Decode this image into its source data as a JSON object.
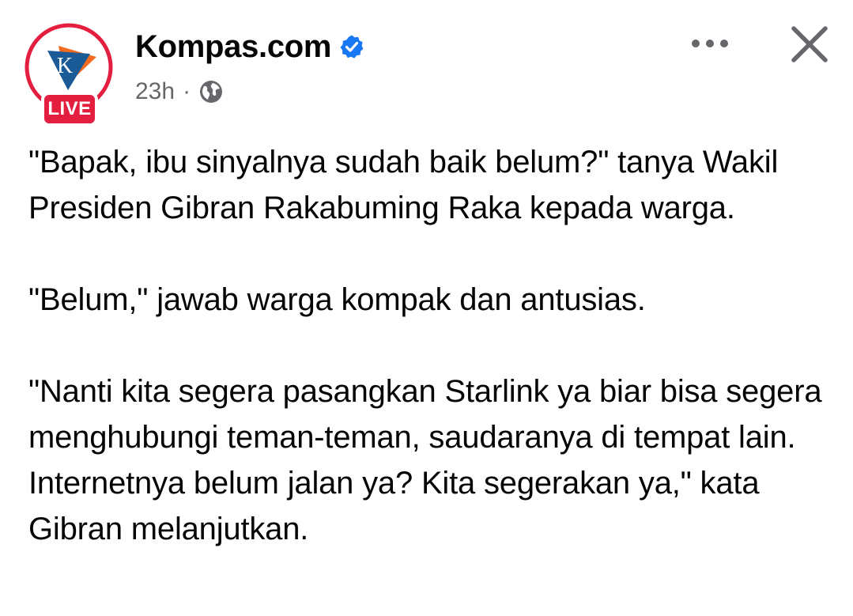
{
  "page": {
    "name": "Kompas.com",
    "verified": true,
    "live_label": "LIVE",
    "avatar_letter": "K"
  },
  "meta": {
    "time": "23h",
    "separator": "·",
    "audience_icon": "globe-icon"
  },
  "actions": {
    "more_icon": "more-horizontal-icon",
    "close_icon": "close-icon"
  },
  "post": {
    "paragraphs": [
      "\"Bapak, ibu sinyalnya sudah baik belum?\" tanya Wakil Presiden Gibran Rakabuming Raka kepada warga.",
      "\"Belum,\" jawab warga kompak dan antusias.",
      "\"Nanti kita segera pasangkan Starlink ya biar bisa segera menghubungi teman-teman, saudaranya di tempat lain. Internetnya belum jalan ya? Kita segerakan ya,\" kata Gibran melanjutkan."
    ]
  },
  "colors": {
    "live_red": "#e41e3f",
    "verified_blue": "#1877f2",
    "kompas_blue": "#1a5a96",
    "kompas_orange": "#f26b21",
    "secondary_text": "#65676b",
    "icon_gray": "#65676b"
  }
}
